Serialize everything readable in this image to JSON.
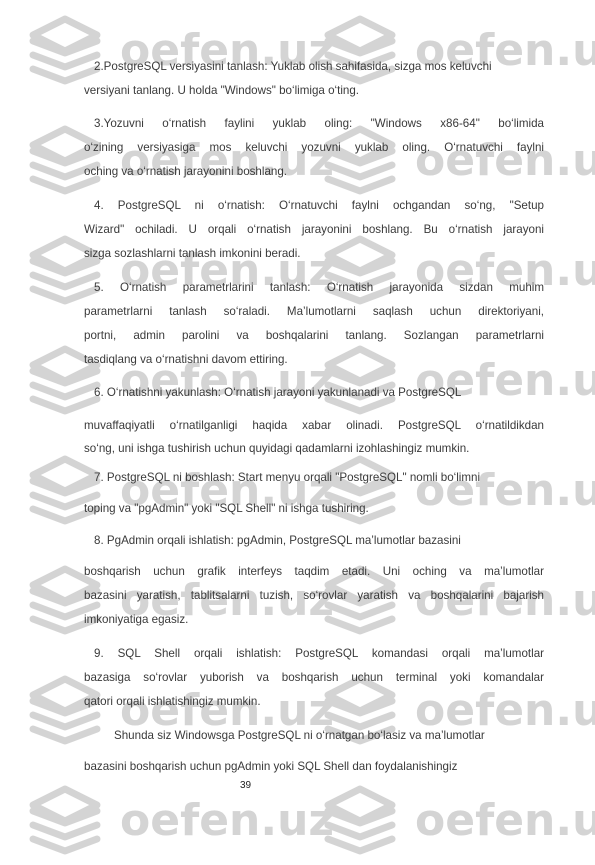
{
  "watermark": {
    "text": "oefen.uz",
    "icon": "stacked-layers-icon",
    "color": "#d4d4d4"
  },
  "paragraphs": [
    {
      "id": "step2",
      "lines": [
        "2.PostgreSQL versiyasini tanlash: Yuklab olish sahifasida, sizga mos keluvchi",
        "versiyani tanlang. U holda \"Windows\" bo‘limiga o‘ting."
      ]
    },
    {
      "id": "step3",
      "lines": [
        "3.Yozuvni o‘rnatish faylini yuklab oling: \"Windows x86-64\" bo‘limida",
        "o‘zining versiyasiga mos keluvchi yozuvni yuklab oling. O‘rnatuvchi faylni",
        "oching va o‘rnatish jarayonini boshlang."
      ]
    },
    {
      "id": "step4",
      "lines": [
        "4. PostgreSQL ni o‘rnatish: O‘rnatuvchi faylni ochgandan so‘ng, \"Setup",
        "Wizard\" ochiladi. U orqali o‘rnatish jarayonini boshlang. Bu o‘rnatish jarayoni",
        "sizga sozlashlarni tanlash imkonini beradi."
      ]
    },
    {
      "id": "step5",
      "lines": [
        "5. O‘rnatish parametrlarini tanlash: O‘rnatish jarayonida sizdan muhim",
        "parametrlarni tanlash so‘raladi. Ma’lumotlarni saqlash uchun direktoriyani,",
        "portni, admin parolini va boshqalarini tanlang. Sozlangan parametrlarni",
        "tasdiqlang va o‘rnatishni davom ettiring."
      ]
    },
    {
      "id": "step6",
      "lines": [
        "6. O‘rnatishni yakunlash: O‘rnatish jarayoni yakunlanadi va PostgreSQL",
        "muvaffaqiyatli o‘rnatilganligi haqida xabar olinadi. PostgreSQL o‘rnatildikdan",
        "so‘ng, uni ishga tushirish uchun quyidagi qadamlarni izohlashingiz mumkin."
      ]
    },
    {
      "id": "step7",
      "lines": [
        "7. PostgreSQL ni boshlash: Start menyu orqali \"PostgreSQL\" nomli bo‘limni",
        "toping va \"pgAdmin\" yoki \"SQL Shell\" ni ishga tushiring."
      ]
    },
    {
      "id": "step8",
      "lines": [
        "8. PgAdmin orqali ishlatish: pgAdmin, PostgreSQL ma’lumotlar bazasini",
        "boshqarish uchun grafik interfeys taqdim etadi. Uni oching va ma’lumotlar",
        "bazasini yaratish, tablitsalarni tuzish, so‘rovlar yaratish va boshqalarini bajarish",
        "imkoniyatiga egasiz."
      ]
    },
    {
      "id": "step9",
      "lines": [
        "9. SQL Shell orqali ishlatish: PostgreSQL komandasi orqali ma’lumotlar",
        "bazasiga so‘rovlar yuborish va boshqarish uchun terminal yoki komandalar",
        "qatori orqali ishlatishingiz mumkin."
      ]
    },
    {
      "id": "conclusion",
      "lines": [
        "Shunda siz Windowsga PostgreSQL ni o‘rnatgan bo‘lasiz va ma’lumotlar",
        "bazasini boshqarish uchun pgAdmin yoki SQL Shell dan foydalanishingiz"
      ]
    }
  ],
  "page_number": "39"
}
